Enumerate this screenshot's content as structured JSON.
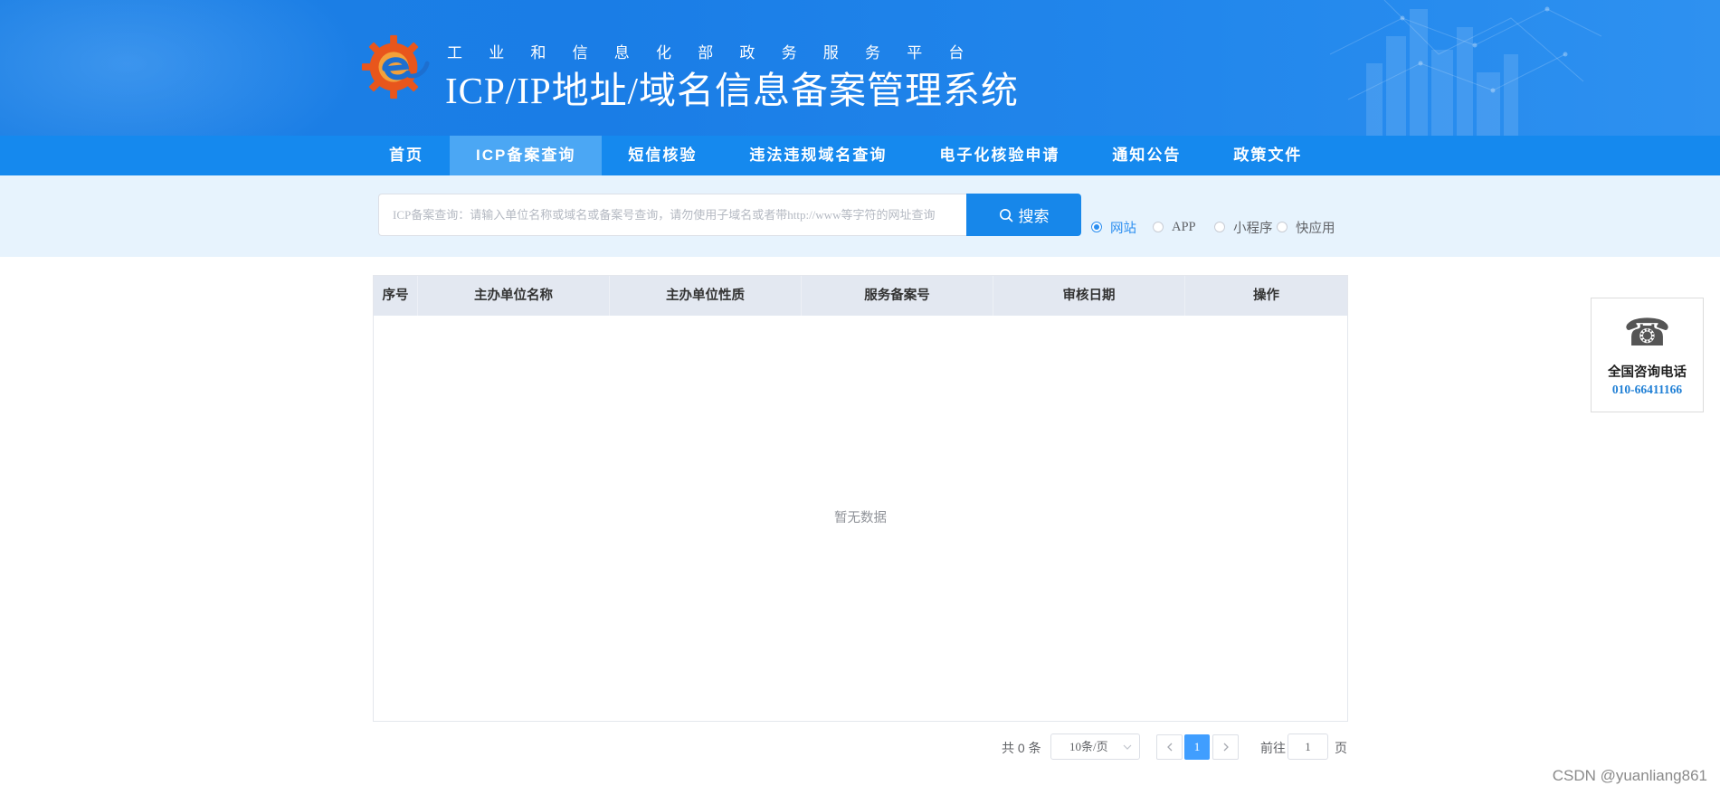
{
  "header": {
    "subtitle": "工业和信息化部政务服务平台",
    "title": "ICP/IP地址/域名信息备案管理系统",
    "logo_icon": "gear-e-logo-icon"
  },
  "nav": {
    "items": [
      {
        "label": "首页",
        "active": false
      },
      {
        "label": "ICP备案查询",
        "active": true
      },
      {
        "label": "短信核验",
        "active": false
      },
      {
        "label": "违法违规域名查询",
        "active": false
      },
      {
        "label": "电子化核验申请",
        "active": false
      },
      {
        "label": "通知公告",
        "active": false
      },
      {
        "label": "政策文件",
        "active": false
      }
    ]
  },
  "search": {
    "placeholder": "ICP备案查询：请输入单位名称或域名或备案号查询，请勿使用子域名或者带http://www等字符的网址查询",
    "value": "",
    "button_label": "搜索",
    "button_icon": "search-icon",
    "types": [
      {
        "label": "网站",
        "checked": true
      },
      {
        "label": "APP",
        "checked": false
      },
      {
        "label": "小程序",
        "checked": false
      },
      {
        "label": "快应用",
        "checked": false
      }
    ]
  },
  "table": {
    "columns": [
      "序号",
      "主办单位名称",
      "主办单位性质",
      "服务备案号",
      "审核日期",
      "操作"
    ],
    "rows": [],
    "empty_text": "暂无数据"
  },
  "pagination": {
    "total_text": "共 0 条",
    "page_size": "10条/页",
    "current_page": "1",
    "goto_label": "前往",
    "goto_value": "1",
    "page_label": "页"
  },
  "contact": {
    "icon": "phone-icon",
    "label": "全国咨询电话",
    "number": "010-66411166"
  },
  "watermark": "CSDN @yuanliang861",
  "colors": {
    "header_blue": "#1c7fe4",
    "nav_blue": "#1589ee",
    "nav_active": "#4ba7f4",
    "search_band": "#e7f3fd",
    "button_blue": "#1787ea",
    "accent": "#409eff",
    "table_header": "#e3e8f1"
  }
}
